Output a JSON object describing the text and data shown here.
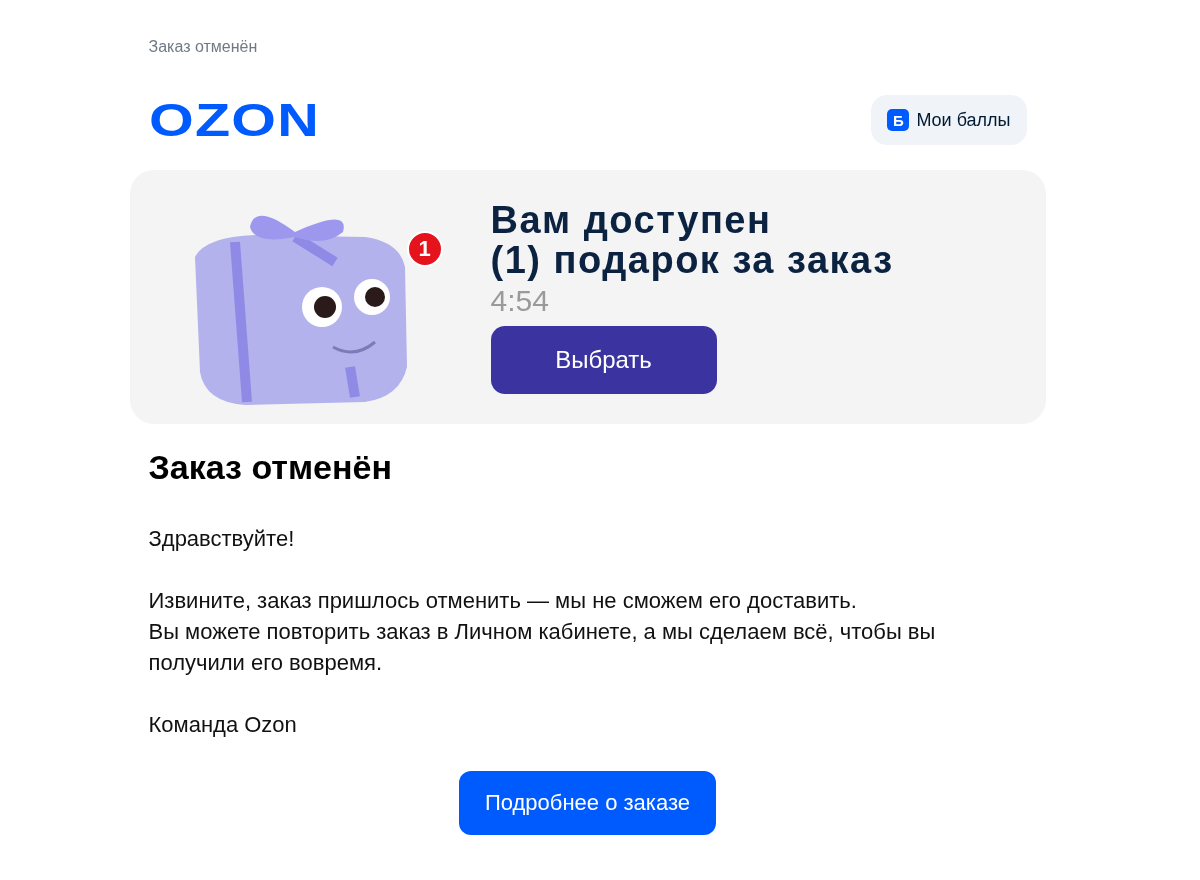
{
  "preheader": "Заказ отменён",
  "header": {
    "logo": "OZON",
    "points_button": {
      "icon": "Б",
      "label": "Мои баллы"
    }
  },
  "promo": {
    "badge": "1",
    "title_lines": [
      "Вам доступен",
      "(1) подарок за заказ"
    ],
    "timer": "4:54",
    "button": "Выбрать"
  },
  "title": "Заказ отменён",
  "paragraphs": [
    "Здравствуйте!",
    "Извините, заказ пришлось отменить — мы не сможем его доставить.\nВы можете повторить заказ в Личном кабинете, а мы сделаем всё, чтобы вы получили его вовремя.",
    "Команда Ozon"
  ],
  "action_button": "Подробнее о заказе"
}
